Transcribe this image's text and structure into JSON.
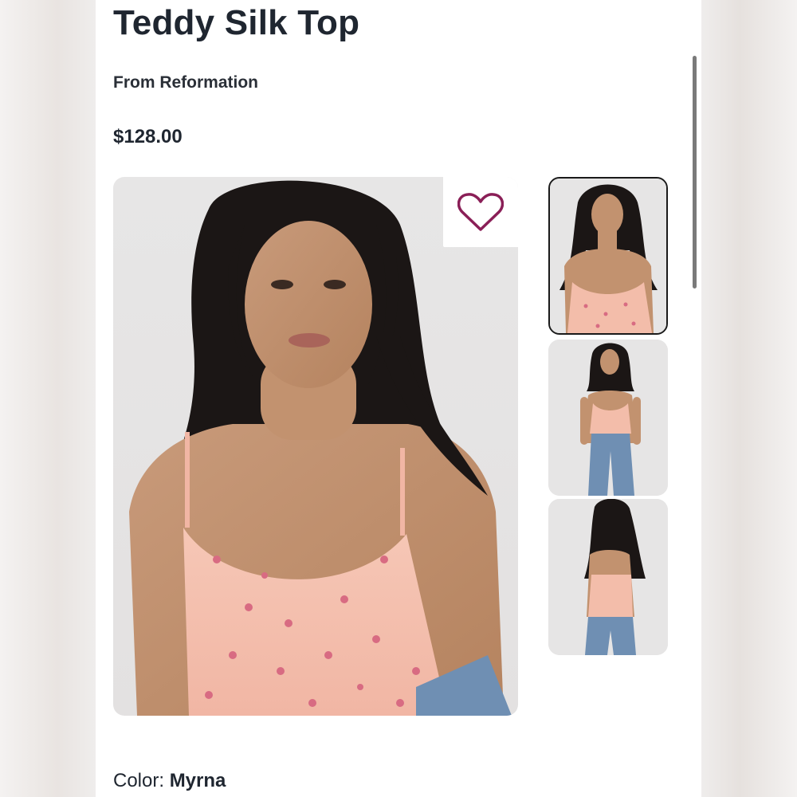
{
  "product": {
    "title": "Teddy Silk Top",
    "brand": "From Reformation",
    "price": "$128.00",
    "color_label": "Color: ",
    "color_value": "Myrna"
  },
  "icons": {
    "wishlist": "heart-icon"
  },
  "gallery": {
    "selected_index": 0,
    "thumbnail_count": 3
  },
  "colors": {
    "heart": "#8a1f57",
    "text": "#1f2630"
  }
}
